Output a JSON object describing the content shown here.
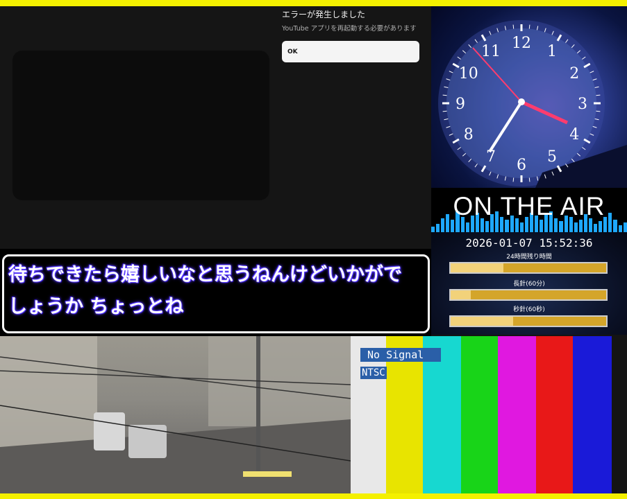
{
  "youtube_error": {
    "title": "エラーが発生しました",
    "message": "YouTube アプリを再起動する必要があります",
    "ok_label": "OK"
  },
  "clock": {
    "numerals": [
      "12",
      "1",
      "2",
      "3",
      "4",
      "5",
      "6",
      "7",
      "8",
      "9",
      "10",
      "11"
    ]
  },
  "on_air": {
    "text": "ON THE AIR"
  },
  "status": {
    "datetime": "2026-01-07 15:52:36",
    "bars": [
      {
        "label": "24時間残り時間",
        "fraction": 0.34
      },
      {
        "label": "長針(60分)",
        "fraction": 0.13
      },
      {
        "label": "秒針(60秒)",
        "fraction": 0.4
      }
    ]
  },
  "subtitle": {
    "line1": "待ちできたら嬉しいなと思うねんけどいかがで",
    "line2": "しょうか ちょっとね"
  },
  "test_pattern": {
    "no_signal": "No Signal",
    "format": "NTSC",
    "colors": [
      "#e8e8e8",
      "#e8e400",
      "#17d8d0",
      "#18d418",
      "#e018e0",
      "#e81818",
      "#1a1ad8",
      "#141414"
    ]
  },
  "colors": {
    "frame_yellow": "#f4f000",
    "equalizer_blue": "#1ea8ff",
    "progress_gold": "#d4a52a"
  }
}
